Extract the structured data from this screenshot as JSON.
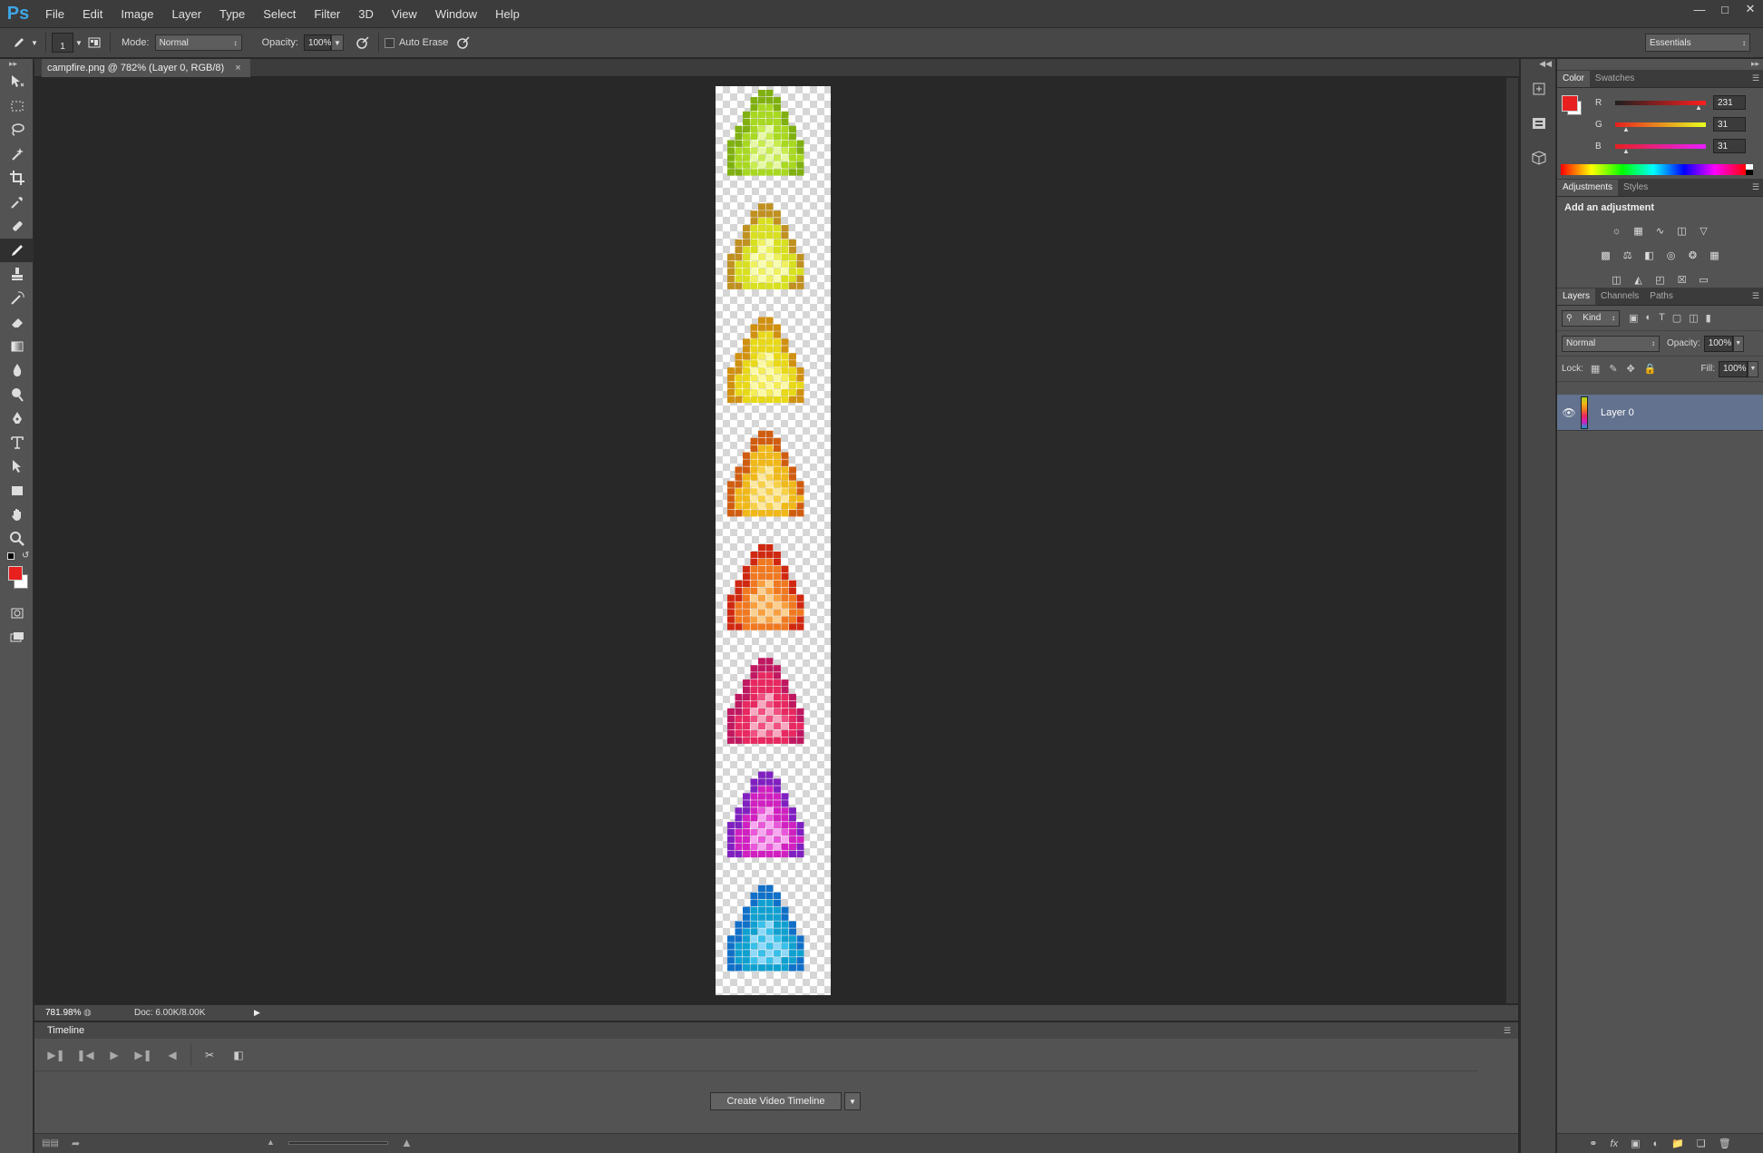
{
  "app": {
    "logo": "Ps"
  },
  "menu": [
    "File",
    "Edit",
    "Image",
    "Layer",
    "Type",
    "Select",
    "Filter",
    "3D",
    "View",
    "Window",
    "Help"
  ],
  "window_controls": [
    "minimize-icon",
    "maximize-icon",
    "close-icon"
  ],
  "options": {
    "brush_size": "1",
    "mode_label": "Mode:",
    "mode_value": "Normal",
    "opacity_label": "Opacity:",
    "opacity_value": "100%",
    "auto_erase_label": "Auto Erase",
    "workspace": "Essentials"
  },
  "document": {
    "tab_title": "campfire.png @ 782% (Layer 0, RGB/8)",
    "close": "×"
  },
  "status": {
    "zoom": "781.98%",
    "doc": "Doc: 6.00K/8.00K"
  },
  "timeline": {
    "title": "Timeline",
    "create_button": "Create Video Timeline"
  },
  "color_panel": {
    "tabs": [
      "Color",
      "Swatches"
    ],
    "foreground": "#e71f1f",
    "channels": [
      {
        "label": "R",
        "value": "231"
      },
      {
        "label": "G",
        "value": "31"
      },
      {
        "label": "B",
        "value": "31"
      }
    ]
  },
  "adjustments_panel": {
    "tabs": [
      "Adjustments",
      "Styles"
    ],
    "title": "Add an adjustment"
  },
  "layers_panel": {
    "tabs": [
      "Layers",
      "Channels",
      "Paths"
    ],
    "kind_label": "Kind",
    "blend_mode": "Normal",
    "opacity_label": "Opacity:",
    "opacity_value": "100%",
    "lock_label": "Lock:",
    "fill_label": "Fill:",
    "fill_value": "100%",
    "layers": [
      {
        "name": "Layer 0",
        "visible": true
      }
    ]
  },
  "sprite_frames": [
    {
      "colors": [
        "#a8d820",
        "#c8ec50",
        "#e6f8a8",
        "#7fb010"
      ]
    },
    {
      "colors": [
        "#d8e020",
        "#eef060",
        "#f8fcb0",
        "#c09020"
      ]
    },
    {
      "colors": [
        "#e8d818",
        "#f4ec58",
        "#fbf8a8",
        "#d09010"
      ]
    },
    {
      "colors": [
        "#f0b818",
        "#f8d048",
        "#fce8a0",
        "#d05c10"
      ]
    },
    {
      "colors": [
        "#f07820",
        "#f8a040",
        "#fcd090",
        "#d02810"
      ]
    },
    {
      "colors": [
        "#e82860",
        "#f05080",
        "#f8a8c0",
        "#c01860"
      ]
    },
    {
      "colors": [
        "#d020c0",
        "#e858d8",
        "#f8a8f0",
        "#8020c0"
      ]
    },
    {
      "colors": [
        "#10a0d0",
        "#38c0e8",
        "#90d8f8",
        "#1070c8"
      ]
    }
  ]
}
